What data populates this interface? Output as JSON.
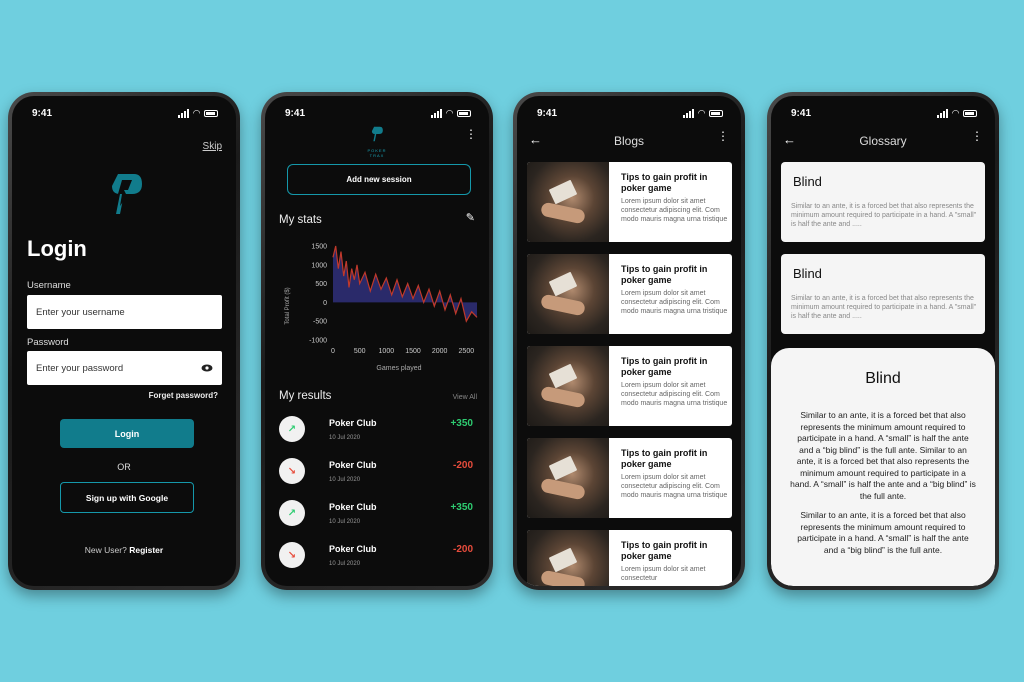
{
  "status_time": "9:41",
  "colors": {
    "background": "#6fcfdf",
    "accent": "#117c8c",
    "positive": "#2ecc71",
    "negative": "#e74c3c",
    "chart_fill": "#2a2a6a",
    "chart_line": "#c0392b"
  },
  "login": {
    "skip": "Skip",
    "title": "Login",
    "username_label": "Username",
    "username_placeholder": "Enter your username",
    "password_label": "Password",
    "password_placeholder": "Enter your password",
    "forgot": "Forget password?",
    "login_button": "Login",
    "or": "OR",
    "google_button": "Sign up with Google",
    "new_user": "New User?",
    "register": "Register"
  },
  "stats": {
    "logo_text": "POKER TRAX",
    "add_session": "Add new session",
    "my_stats": "My stats",
    "my_results": "My results",
    "view_all": "View All",
    "results": [
      {
        "name": "Poker Club",
        "date": "10 Jul 2020",
        "amount": "+350",
        "trend": "up"
      },
      {
        "name": "Poker Club",
        "date": "10 Jul 2020",
        "amount": "-200",
        "trend": "down"
      },
      {
        "name": "Poker Club",
        "date": "10 Jul 2020",
        "amount": "+350",
        "trend": "up"
      },
      {
        "name": "Poker Club",
        "date": "10 Jul 2020",
        "amount": "-200",
        "trend": "down"
      }
    ]
  },
  "chart_data": {
    "type": "area",
    "title": "",
    "xlabel": "Games played",
    "ylabel": "Total Profit ($)",
    "xlim": [
      0,
      2700
    ],
    "ylim": [
      -1000,
      1500
    ],
    "x_ticks": [
      "0",
      "500",
      "1000",
      "1500",
      "2000",
      "2500"
    ],
    "y_ticks": [
      "1500",
      "1000",
      "500",
      "0",
      "-500",
      "-1000"
    ],
    "x": [
      0,
      50,
      100,
      150,
      200,
      250,
      300,
      350,
      400,
      450,
      500,
      600,
      700,
      800,
      900,
      1000,
      1100,
      1200,
      1300,
      1400,
      1500,
      1600,
      1700,
      1800,
      1900,
      2000,
      2100,
      2200,
      2300,
      2400,
      2500,
      2600,
      2700
    ],
    "values": [
      1200,
      1500,
      900,
      1350,
      700,
      1100,
      400,
      900,
      600,
      1000,
      500,
      800,
      300,
      750,
      350,
      650,
      200,
      600,
      150,
      500,
      100,
      450,
      0,
      350,
      -100,
      300,
      -200,
      200,
      -300,
      100,
      -500,
      -250,
      -400
    ]
  },
  "blogs": {
    "title": "Blogs",
    "items": [
      {
        "title": "Tips to gain profit in poker game",
        "desc": "Lorem ipsum dolor sit amet consectetur adipiscing elit. Com modo mauris magna urna tristique"
      },
      {
        "title": "Tips to gain profit in poker game",
        "desc": "Lorem ipsum dolor sit amet consectetur adipiscing elit. Com modo mauris magna urna tristique"
      },
      {
        "title": "Tips to gain profit in poker game",
        "desc": "Lorem ipsum dolor sit amet consectetur adipiscing elit. Com modo mauris magna urna tristique"
      },
      {
        "title": "Tips to gain profit in poker game",
        "desc": "Lorem ipsum dolor sit amet consectetur adipiscing elit. Com modo mauris magna urna tristique"
      },
      {
        "title": "Tips to gain profit in poker game",
        "desc": "Lorem ipsum dolor sit amet consectetur"
      }
    ]
  },
  "glossary": {
    "title": "Glossary",
    "cards": [
      {
        "title": "Blind",
        "desc": "Similar to an ante, it is a forced bet that also represents the minimum amount required to participate in a hand. A \"small\" is half the ante and ....."
      },
      {
        "title": "Blind",
        "desc": "Similar to an ante, it is a forced bet that also represents the minimum amount required to participate in a hand. A \"small\" is half the ante and ....."
      }
    ],
    "sheet_title": "Blind",
    "sheet_paragraphs": [
      "Similar to an ante, it is a forced bet that also represents the minimum amount required to participate in a hand. A “small” is half the ante and a “big blind” is the full ante. Similar to an ante, it is a forced bet that also represents the minimum amount required to participate in a hand. A “small” is half the ante and a “big blind” is the full ante.",
      "Similar to an ante, it is a forced bet that also represents the minimum amount required to participate in a hand. A “small” is half the ante and a “big blind” is the full ante."
    ]
  }
}
